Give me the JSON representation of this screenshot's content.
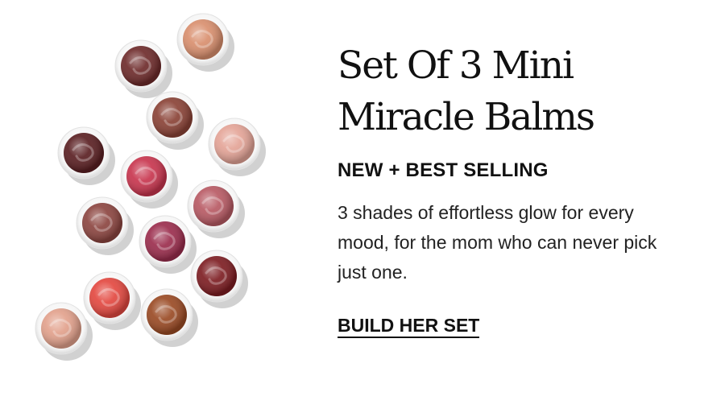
{
  "headline": {
    "line1": "Set Of 3 Mini",
    "line2": "Miracle Balms"
  },
  "eyebrow": "NEW + BEST SELLING",
  "body": "3 shades of effortless glow for every mood, for the mom who can never pick just one.",
  "cta": {
    "label": "BUILD HER SET"
  },
  "colors": {
    "text": "#111111",
    "background": "#ffffff"
  },
  "balm_shades": [
    "#d98f6e",
    "#6e2b2b",
    "#8a4236",
    "#e4a497",
    "#5a1f22",
    "#c8354e",
    "#b85a64",
    "#8c4540",
    "#9b2d4d",
    "#7d1d22",
    "#e34840",
    "#9a4a24",
    "#e2a18c"
  ]
}
